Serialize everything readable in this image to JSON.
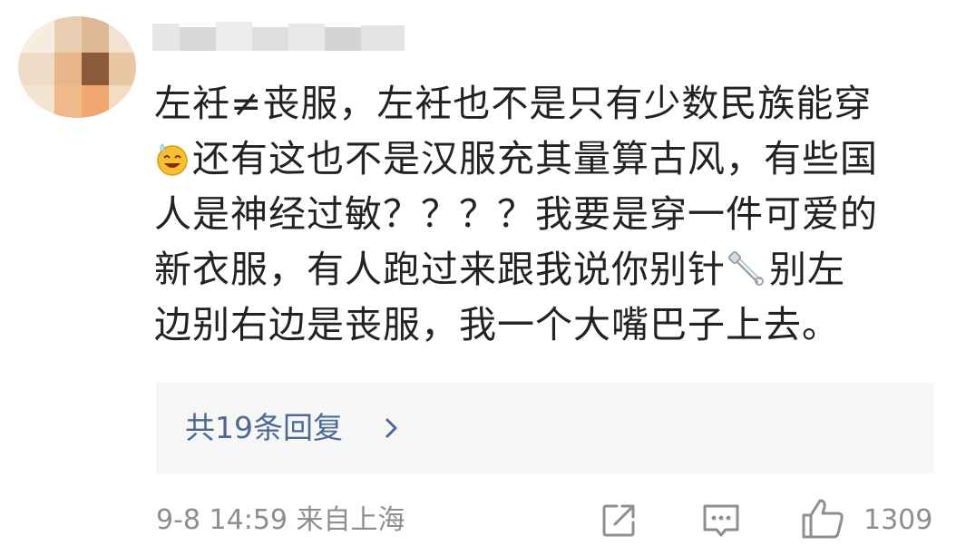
{
  "comment": {
    "username_text": "",
    "lines": [
      "左衽≠丧服，左衽也不是只有少数民族能穿",
      "还有这也不是汉服充其量算古风，有些国",
      "人是神经过敏？？？？我要是穿一件可爱的",
      "新衣服，有人跑过来跟我说你别针",
      "别左",
      "边别右边是丧服，我一个大嘴巴子上去。"
    ],
    "icons": {
      "avatar": "user-avatar-pixelated",
      "emoji": "smiling-sweat-emoji",
      "pin": "safety-pin-emoji"
    }
  },
  "replies": {
    "label": "共19条回复",
    "chevron": "chevron-right-icon",
    "color": "#4c6a94"
  },
  "footer": {
    "timestamp": "9-8 14:59  来自上海",
    "share_icon": "share-icon",
    "comment_icon": "comment-icon",
    "like_icon": "thumbs-up-icon",
    "like_count": "1309",
    "meta_color": "#8e8e8e"
  }
}
